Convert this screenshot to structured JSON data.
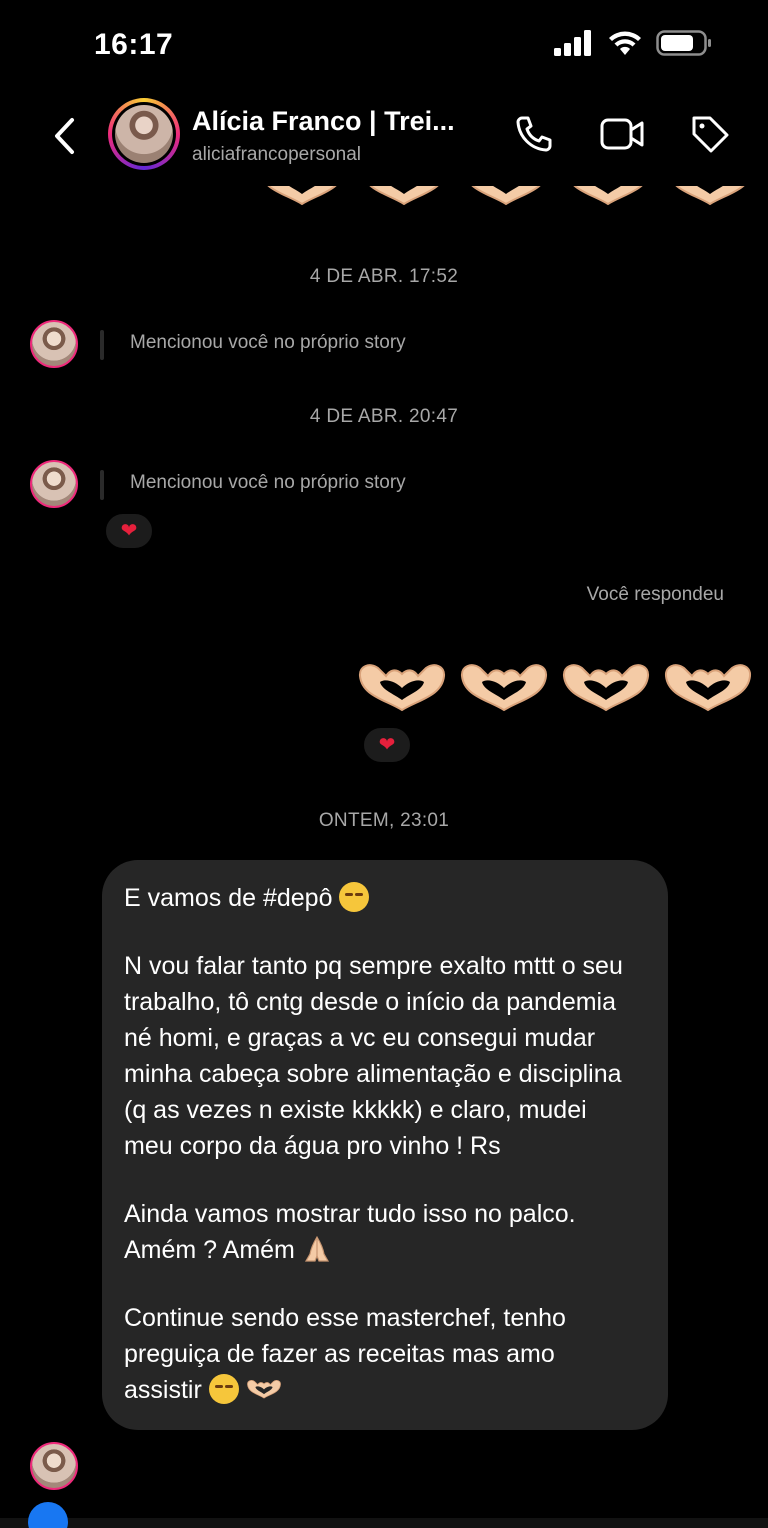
{
  "status_bar": {
    "time": "16:17"
  },
  "header": {
    "name": "Alícia Franco | Trei...",
    "username": "aliciafrancopersonal"
  },
  "messages": {
    "timestamp_1": "4 DE ABR. 17:52",
    "mention_1": "Mencionou você no próprio story",
    "timestamp_2": "4 DE ABR. 20:47",
    "mention_2": "Mencionou você no próprio story",
    "reaction_1": "❤",
    "replied_label": "Você respondeu",
    "reaction_2": "❤",
    "timestamp_3": "ONTEM, 23:01",
    "bubble": {
      "p1": "E vamos de #depô",
      "p2": "N vou falar tanto pq sempre exalto mttt o seu trabalho, tô cntg desde o início da pandemia né homi, e graças a vc eu consegui mudar minha cabeça sobre alimentação e disciplina (q as vezes n existe kkkkk) e claro, mudei meu corpo da água pro vinho ! Rs",
      "p3": "Ainda vamos mostrar tudo isso no palco. Amém ? Amém",
      "p4": "Continue sendo esse masterchef, tenho preguiça de fazer as receitas mas amo assistir"
    }
  },
  "icons": {
    "back": "chevron-left-icon",
    "call": "phone-icon",
    "video": "video-camera-icon",
    "tag": "tag-icon",
    "heart_hands": "heart-hands-emoji",
    "pray": "folded-hands-emoji",
    "relieved_face": "relieved-face-emoji",
    "shushing_face": "shushing-face-emoji"
  },
  "colors": {
    "background": "#000000",
    "bubble": "#262626",
    "muted_text": "#a8a8a8",
    "heart": "#e6203c",
    "story_ring_pink": "#ee2a7b"
  }
}
